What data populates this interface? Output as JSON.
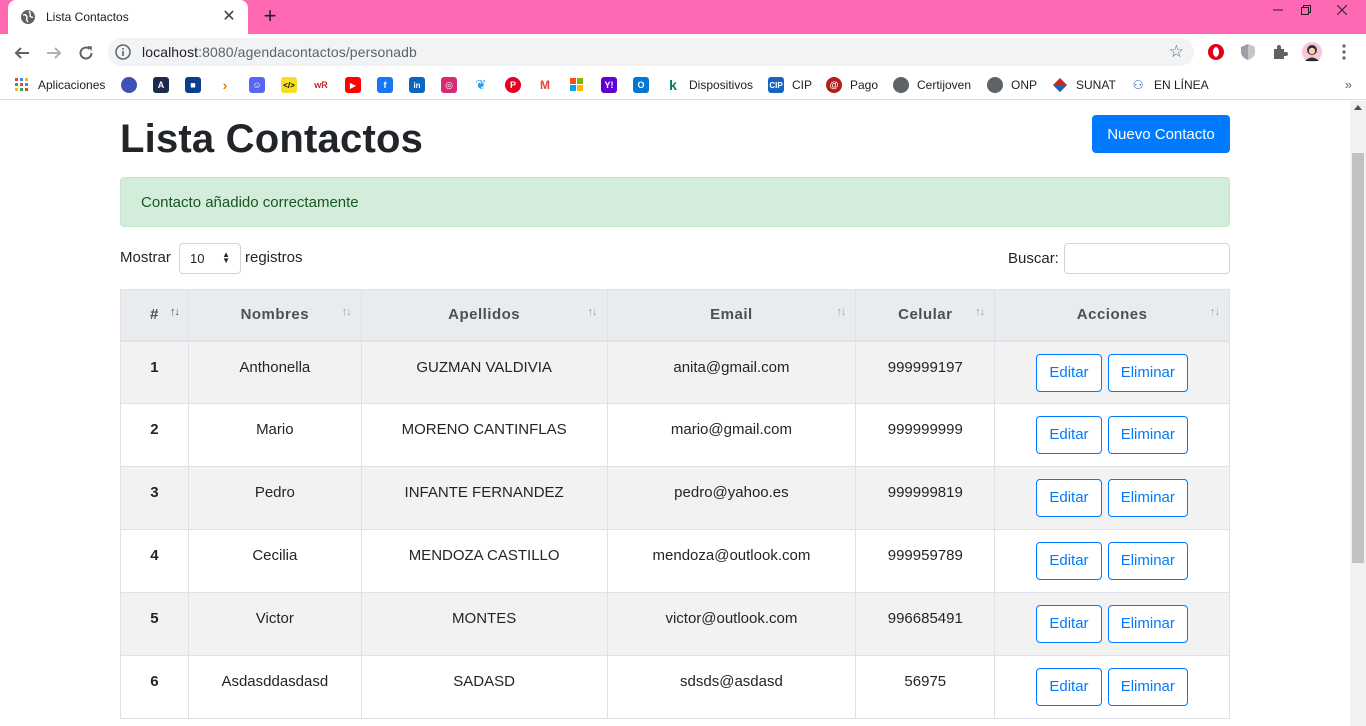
{
  "browser": {
    "tab_title": "Lista Contactos",
    "tab_close": "✕",
    "new_tab": "+",
    "url_host": "localhost",
    "url_rest": ":8080/agendacontactos/personadb",
    "bookmarks": [
      {
        "label": "Aplicaciones",
        "icon": "apps-grid-icon"
      },
      {
        "label": "",
        "icon": "web-icon"
      },
      {
        "label": "",
        "icon": "a-logo-icon"
      },
      {
        "label": "",
        "icon": "square-logo-icon"
      },
      {
        "label": "",
        "icon": "arrow-logo-icon"
      },
      {
        "label": "",
        "icon": "discord-icon"
      },
      {
        "label": "",
        "icon": "code-icon"
      },
      {
        "label": "",
        "icon": "wr-icon"
      },
      {
        "label": "",
        "icon": "youtube-icon"
      },
      {
        "label": "",
        "icon": "facebook-icon"
      },
      {
        "label": "",
        "icon": "linkedin-icon"
      },
      {
        "label": "",
        "icon": "instagram-icon"
      },
      {
        "label": "",
        "icon": "twitter-icon"
      },
      {
        "label": "",
        "icon": "pinterest-icon"
      },
      {
        "label": "",
        "icon": "gmail-icon"
      },
      {
        "label": "",
        "icon": "microsoft-icon"
      },
      {
        "label": "",
        "icon": "yahoo-icon"
      },
      {
        "label": "",
        "icon": "outlook-icon"
      },
      {
        "label": "Dispositivos",
        "icon": "k-logo-icon"
      },
      {
        "label": "CIP",
        "icon": "cip-icon"
      },
      {
        "label": "Pago",
        "icon": "pago-icon"
      },
      {
        "label": "Certijoven",
        "icon": "globe-icon"
      },
      {
        "label": "ONP",
        "icon": "globe-icon"
      },
      {
        "label": "SUNAT",
        "icon": "sunat-icon"
      },
      {
        "label": "EN LÍNEA",
        "icon": "people-icon"
      }
    ],
    "bookmarks_more": "»"
  },
  "page": {
    "title": "Lista Contactos",
    "new_contact_label": "Nuevo Contacto",
    "alert_text": "Contacto añadido correctamente",
    "length_prefix": "Mostrar",
    "length_value": "10",
    "length_suffix": "registros",
    "search_label": "Buscar:",
    "search_value": ""
  },
  "table": {
    "headers": [
      "#",
      "Nombres",
      "Apellidos",
      "Email",
      "Celular",
      "Acciones"
    ],
    "edit_label": "Editar",
    "delete_label": "Eliminar",
    "rows": [
      {
        "id": "1",
        "nombres": "Anthonella",
        "apellidos": "GUZMAN VALDIVIA",
        "email": "anita@gmail.com",
        "celular": "999999197"
      },
      {
        "id": "2",
        "nombres": "Mario",
        "apellidos": "MORENO CANTINFLAS",
        "email": "mario@gmail.com",
        "celular": "999999999"
      },
      {
        "id": "3",
        "nombres": "Pedro",
        "apellidos": "INFANTE FERNANDEZ",
        "email": "pedro@yahoo.es",
        "celular": "999999819"
      },
      {
        "id": "4",
        "nombres": "Cecilia",
        "apellidos": "MENDOZA CASTILLO",
        "email": "mendoza@outlook.com",
        "celular": "999959789"
      },
      {
        "id": "5",
        "nombres": "Victor",
        "apellidos": "MONTES",
        "email": "victor@outlook.com",
        "celular": "996685491"
      },
      {
        "id": "6",
        "nombres": "Asdasddasdasd",
        "apellidos": "SADASD",
        "email": "sdsds@asdasd",
        "celular": "56975"
      }
    ]
  }
}
